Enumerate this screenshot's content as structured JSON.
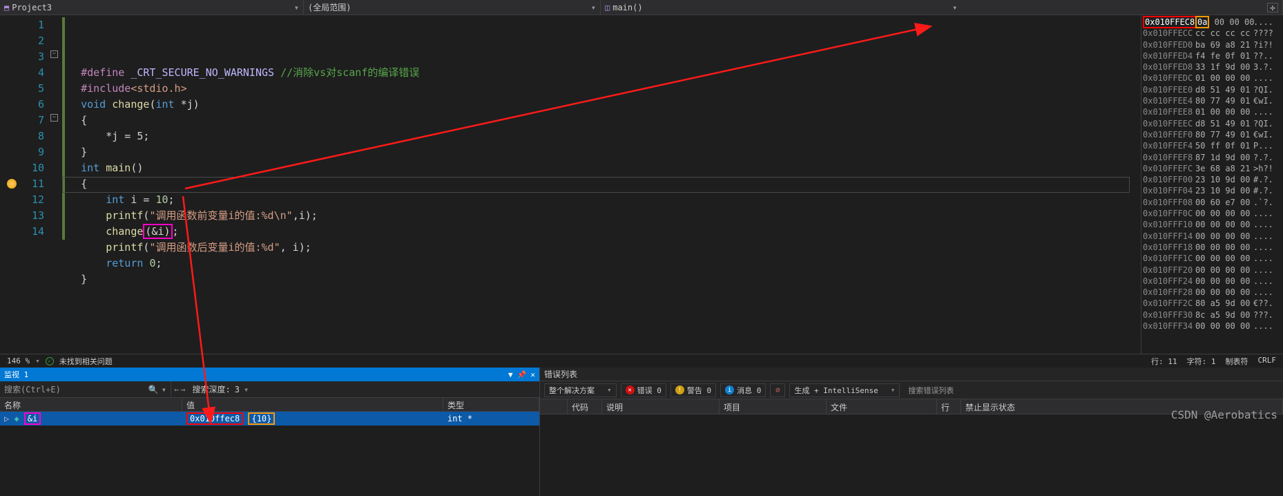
{
  "topbar": {
    "project": "Project3",
    "scope": "(全局范围)",
    "function": "main()"
  },
  "code": {
    "define": "#define",
    "macro": "_CRT_SECURE_NO_WARNINGS",
    "comment": "//消除vs对scanf的编译错误",
    "include": "#include",
    "header": "<stdio.h>",
    "void": "void",
    "change_fn": "change",
    "int": "int",
    "ptr": "*j",
    "assign": "*j = 5;",
    "main_fn": "main",
    "decl": "int i = 10;",
    "printf": "printf",
    "str1": "\"调用函数前变量i的值:%d\\n\"",
    "arg_i": ",i);",
    "change_call": "change",
    "amp_i": "(&i)",
    "semi": ";",
    "str2": "\"调用函数后变量i的值:%d\"",
    "arg_i2": ", i);",
    "return": "return 0;"
  },
  "lines": [
    "1",
    "2",
    "3",
    "4",
    "5",
    "6",
    "7",
    "8",
    "9",
    "10",
    "11",
    "12",
    "13",
    "14"
  ],
  "memory": [
    {
      "a": "0x010FFEC8",
      "h": "0a 00 00 00",
      "s": "...."
    },
    {
      "a": "0x010FFECC",
      "h": "cc cc cc cc",
      "s": "????"
    },
    {
      "a": "0x010FFED0",
      "h": "ba 69 a8 21",
      "s": "?i?!"
    },
    {
      "a": "0x010FFED4",
      "h": "f4 fe 0f 01",
      "s": "??.."
    },
    {
      "a": "0x010FFED8",
      "h": "33 1f 9d 00",
      "s": "3.?."
    },
    {
      "a": "0x010FFEDC",
      "h": "01 00 00 00",
      "s": "...."
    },
    {
      "a": "0x010FFEE0",
      "h": "d8 51 49 01",
      "s": "?QI."
    },
    {
      "a": "0x010FFEE4",
      "h": "80 77 49 01",
      "s": "€wI."
    },
    {
      "a": "0x010FFEE8",
      "h": "01 00 00 00",
      "s": "...."
    },
    {
      "a": "0x010FFEEC",
      "h": "d8 51 49 01",
      "s": "?QI."
    },
    {
      "a": "0x010FFEF0",
      "h": "80 77 49 01",
      "s": "€wI."
    },
    {
      "a": "0x010FFEF4",
      "h": "50 ff 0f 01",
      "s": "P..."
    },
    {
      "a": "0x010FFEF8",
      "h": "87 1d 9d 00",
      "s": "?.?."
    },
    {
      "a": "0x010FFEFC",
      "h": "3e 68 a8 21",
      "s": ">h?!"
    },
    {
      "a": "0x010FFF00",
      "h": "23 10 9d 00",
      "s": "#.?."
    },
    {
      "a": "0x010FFF04",
      "h": "23 10 9d 00",
      "s": "#.?."
    },
    {
      "a": "0x010FFF08",
      "h": "00 60 e7 00",
      "s": ".`?."
    },
    {
      "a": "0x010FFF0C",
      "h": "00 00 00 00",
      "s": "...."
    },
    {
      "a": "0x010FFF10",
      "h": "00 00 00 00",
      "s": "...."
    },
    {
      "a": "0x010FFF14",
      "h": "00 00 00 00",
      "s": "...."
    },
    {
      "a": "0x010FFF18",
      "h": "00 00 00 00",
      "s": "...."
    },
    {
      "a": "0x010FFF1C",
      "h": "00 00 00 00",
      "s": "...."
    },
    {
      "a": "0x010FFF20",
      "h": "00 00 00 00",
      "s": "...."
    },
    {
      "a": "0x010FFF24",
      "h": "00 00 00 00",
      "s": "...."
    },
    {
      "a": "0x010FFF28",
      "h": "00 00 00 00",
      "s": "...."
    },
    {
      "a": "0x010FFF2C",
      "h": "80 a5 9d 00",
      "s": "€??."
    },
    {
      "a": "0x010FFF30",
      "h": "8c a5 9d 00",
      "s": "???."
    },
    {
      "a": "0x010FFF34",
      "h": "00 00 00 00",
      "s": "...."
    }
  ],
  "status": {
    "zoom": "146 %",
    "issues": "未找到相关问题",
    "line": "行: 11",
    "col": "字符: 1",
    "tabs": "制表符",
    "crlf": "CRLF"
  },
  "watch": {
    "title": "监视 1",
    "search_ph": "搜索(Ctrl+E)",
    "depth_label": "搜索深度:",
    "depth_val": "3",
    "col_name": "名称",
    "col_val": "值",
    "col_type": "类型",
    "row": {
      "name": "&i",
      "addr": "0x010ffec8",
      "val": "{10}",
      "type": "int *"
    }
  },
  "errlist": {
    "title": "错误列表",
    "solution": "整个解决方案",
    "errors": "错误 0",
    "warnings": "警告 0",
    "messages": "消息 0",
    "gen": "生成 + IntelliSense",
    "search_ph": "搜索错误列表",
    "cols": {
      "code": "代码",
      "desc": "说明",
      "proj": "项目",
      "file": "文件",
      "line": "行",
      "supp": "禁止显示状态"
    }
  },
  "watermark": "CSDN @Aerobatics"
}
